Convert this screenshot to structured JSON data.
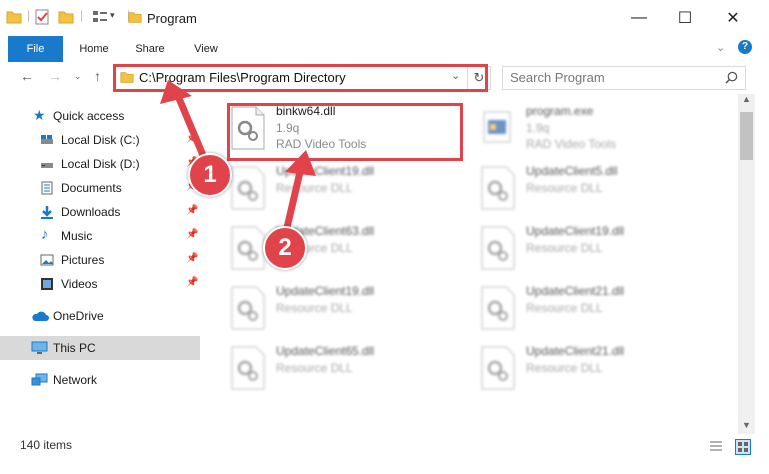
{
  "window": {
    "title": "Program"
  },
  "ribbon": {
    "tabs": [
      "File",
      "Home",
      "Share",
      "View"
    ]
  },
  "address_bar": {
    "path": "C:\\Program Files\\Program Directory",
    "search_placeholder": "Search Program"
  },
  "sidebar": {
    "items": [
      {
        "label": "Quick access",
        "icon": "star-icon",
        "pinned": false
      },
      {
        "label": "Local Disk (C:)",
        "icon": "drive-icon",
        "pinned": true
      },
      {
        "label": "Local Disk (D:)",
        "icon": "drive-icon",
        "pinned": true
      },
      {
        "label": "Documents",
        "icon": "documents-icon",
        "pinned": true
      },
      {
        "label": "Downloads",
        "icon": "download-icon",
        "pinned": true
      },
      {
        "label": "Music",
        "icon": "music-icon",
        "pinned": true
      },
      {
        "label": "Pictures",
        "icon": "pictures-icon",
        "pinned": true
      },
      {
        "label": "Videos",
        "icon": "videos-icon",
        "pinned": true
      },
      {
        "label": "OneDrive",
        "icon": "cloud-icon",
        "pinned": false
      },
      {
        "label": "This PC",
        "icon": "computer-icon",
        "pinned": false,
        "selected": true
      },
      {
        "label": "Network",
        "icon": "network-icon",
        "pinned": false
      }
    ]
  },
  "files": [
    {
      "name": "binkw64.dll",
      "line2": "1.9q",
      "line3": "RAD Video Tools"
    },
    {
      "name": "program.exe",
      "line2": "1.9q",
      "line3": "RAD Video Tools"
    },
    {
      "name": "UpdateClient19.dll",
      "line2": "Resource DLL"
    },
    {
      "name": "UpdateClient5.dll",
      "line2": "Resource DLL"
    },
    {
      "name": "UpdateClient63.dll",
      "line2": "Resource DLL"
    },
    {
      "name": "UpdateClient19.dll",
      "line2": "Resource DLL"
    },
    {
      "name": "UpdateClient19.dll",
      "line2": "Resource DLL"
    },
    {
      "name": "UpdateClient21.dll",
      "line2": "Resource DLL"
    },
    {
      "name": "UpdateClient65.dll",
      "line2": "Resource DLL"
    },
    {
      "name": "UpdateClient21.dll",
      "line2": "Resource DLL"
    }
  ],
  "status": {
    "item_count": "140 items"
  },
  "annotations": {
    "badge1": "1",
    "badge2": "2",
    "color": "#e0434a"
  }
}
